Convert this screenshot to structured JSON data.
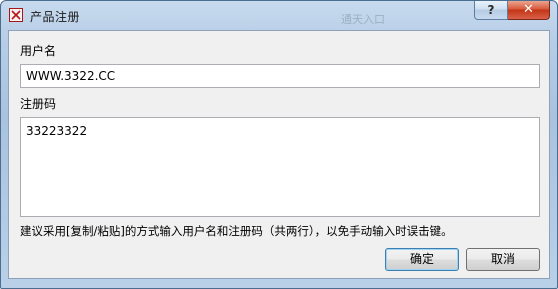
{
  "window": {
    "title": "产品注册",
    "background_text": "通天入口",
    "help_label": "?",
    "close_label": "✕"
  },
  "form": {
    "username_label": "用户名",
    "username_value": "WWW.3322.CC",
    "regcode_label": "注册码",
    "regcode_value": "33223322",
    "hint": "建议采用[复制/粘贴]的方式输入用户名和注册码（共两行），以免手动输入时误击键。"
  },
  "buttons": {
    "ok": "确定",
    "cancel": "取消"
  },
  "icons": {
    "app": "registration-app-icon",
    "help": "question-mark-icon",
    "close": "close-x-icon"
  },
  "colors": {
    "title_bar": "#b7cde6",
    "close_button": "#c33414",
    "client_background": "#f0f0f0",
    "default_button_border": "#3c7fb1"
  }
}
